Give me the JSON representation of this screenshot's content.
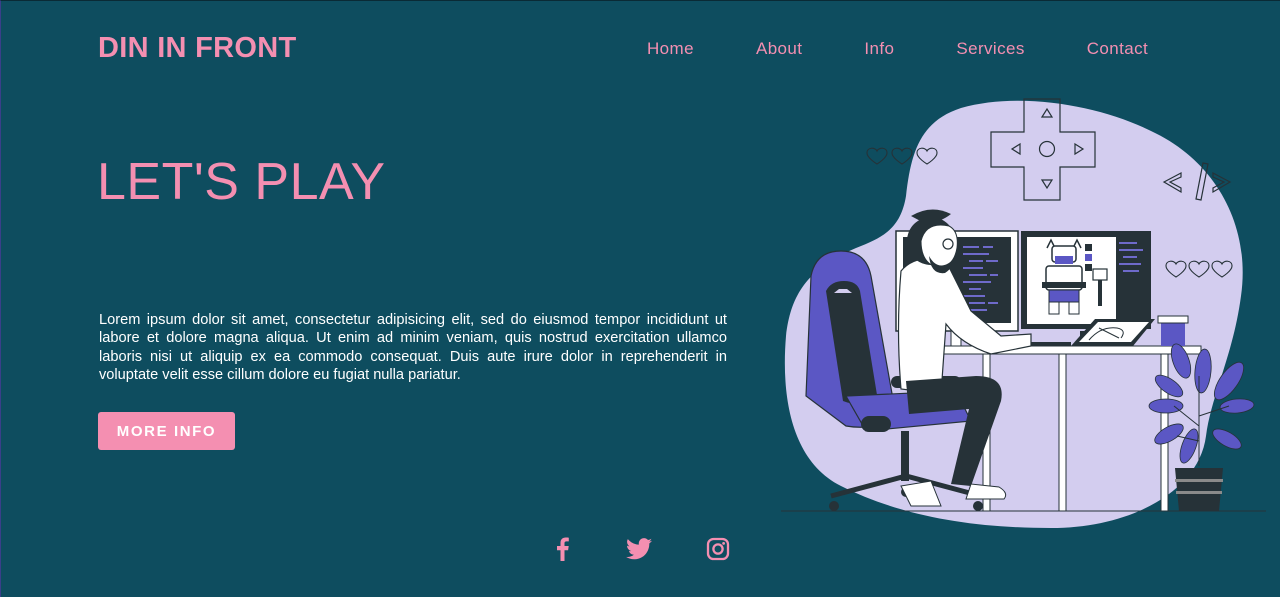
{
  "header": {
    "logo": "DIN IN FRONT",
    "nav": [
      {
        "label": "Home"
      },
      {
        "label": "About"
      },
      {
        "label": "Info"
      },
      {
        "label": "Services"
      },
      {
        "label": "Contact"
      }
    ]
  },
  "hero": {
    "title": "LET'S PLAY",
    "body": "Lorem ipsum dolor sit amet, consectetur adipisicing elit, sed do eiusmod tempor incididunt ut labore et dolore magna aliqua. Ut enim ad minim veniam, quis nostrud exercitation ullamco laboris nisi ut aliquip ex ea commodo consequat. Duis aute irure dolor in reprehenderit in voluptate velit esse cillum dolore eu fugiat nulla pariatur.",
    "button_label": "MORE INFO"
  },
  "social": [
    {
      "icon": "facebook-icon"
    },
    {
      "icon": "twitter-icon"
    },
    {
      "icon": "instagram-icon"
    }
  ],
  "colors": {
    "background": "#0e4d5f",
    "accent": "#f48fb1",
    "blob": "#d3cdef",
    "purple": "#5b57c4",
    "dark": "#263238"
  }
}
